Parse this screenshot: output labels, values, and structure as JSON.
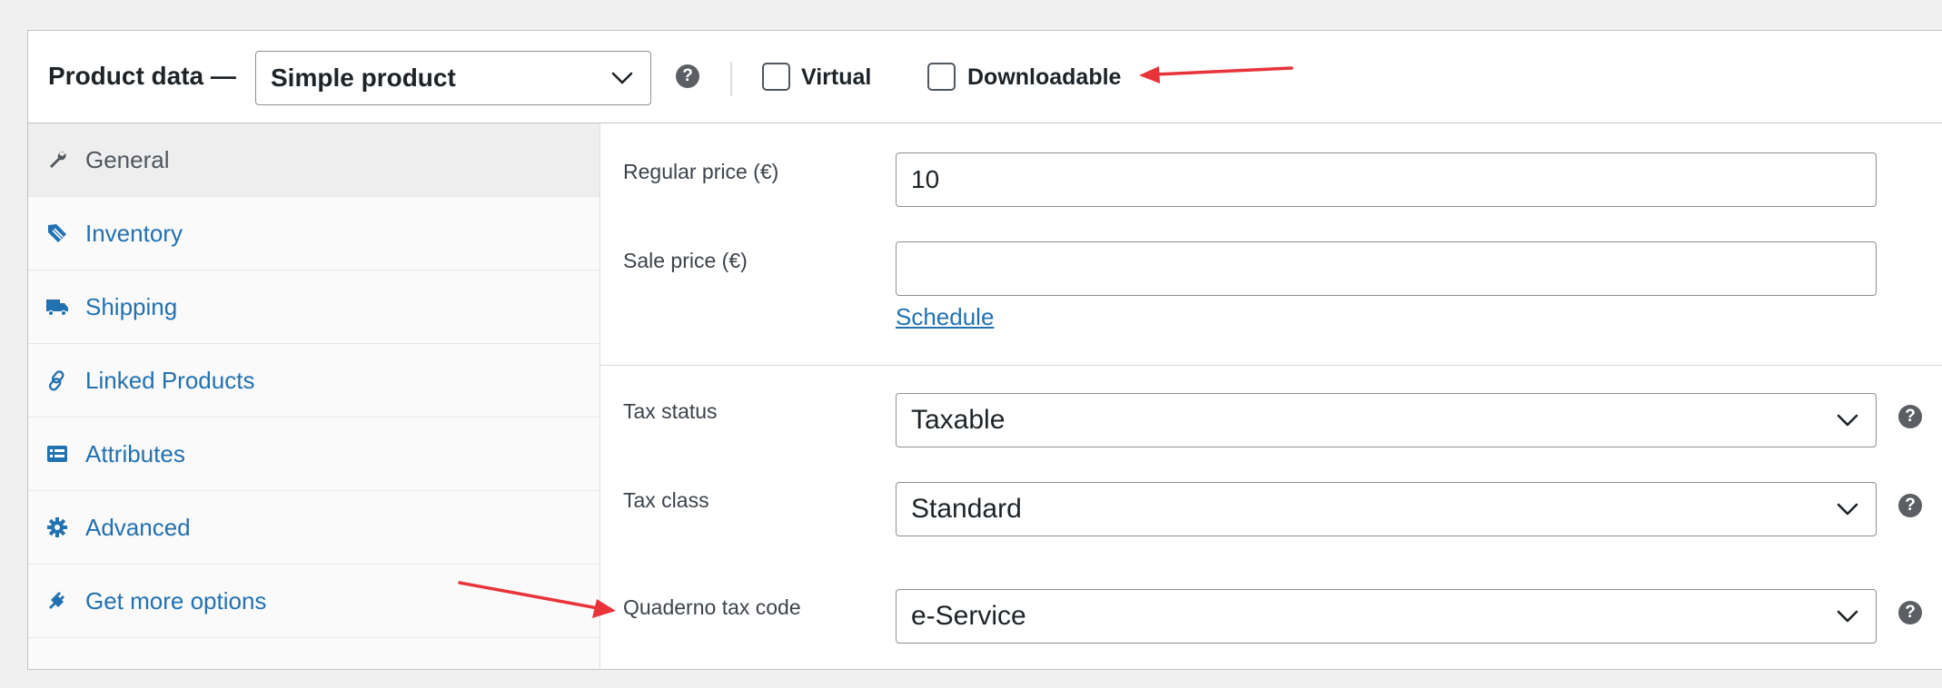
{
  "header": {
    "title": "Product data —",
    "product_type": "Simple product",
    "help_icon": "question-circle-icon",
    "virtual_label": "Virtual",
    "downloadable_label": "Downloadable",
    "virtual_checked": false,
    "downloadable_checked": false
  },
  "tabs": [
    {
      "label": "General",
      "icon": "wrench-icon",
      "active": true
    },
    {
      "label": "Inventory",
      "icon": "tag-icon",
      "active": false
    },
    {
      "label": "Shipping",
      "icon": "truck-icon",
      "active": false
    },
    {
      "label": "Linked Products",
      "icon": "link-icon",
      "active": false
    },
    {
      "label": "Attributes",
      "icon": "list-icon",
      "active": false
    },
    {
      "label": "Advanced",
      "icon": "gear-icon",
      "active": false
    },
    {
      "label": "Get more options",
      "icon": "plug-icon",
      "active": false
    }
  ],
  "general": {
    "regular_price_label": "Regular price (€)",
    "regular_price_value": "10",
    "sale_price_label": "Sale price (€)",
    "sale_price_value": "",
    "schedule_link": "Schedule",
    "tax_status_label": "Tax status",
    "tax_status_value": "Taxable",
    "tax_class_label": "Tax class",
    "tax_class_value": "Standard",
    "quaderno_label": "Quaderno tax code",
    "quaderno_value": "e-Service"
  },
  "colors": {
    "link": "#2271b1",
    "annotation_arrow": "#e8333b",
    "help_icon": "#5b5e63"
  }
}
